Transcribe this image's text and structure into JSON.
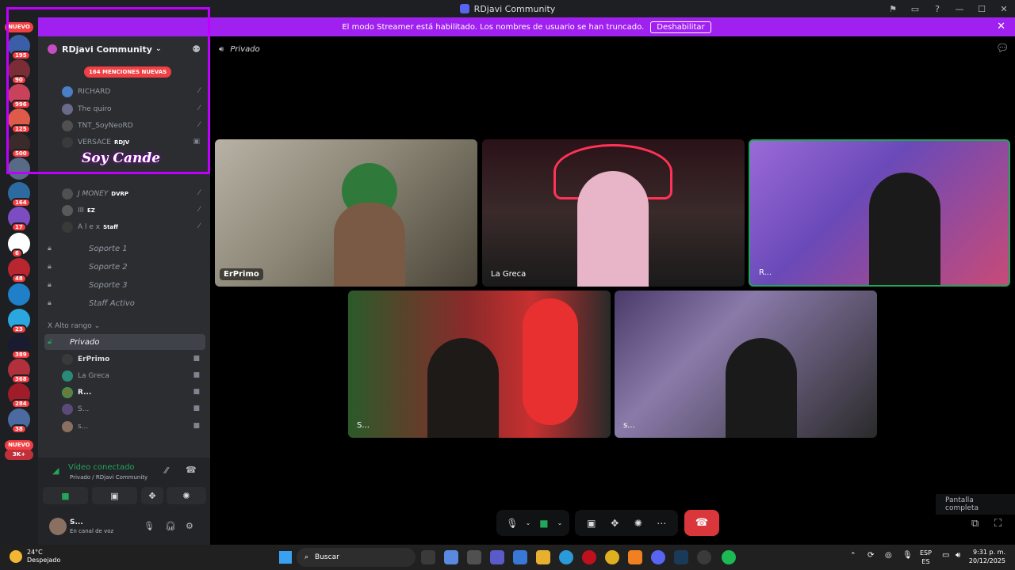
{
  "window": {
    "title": "RDjavi Community"
  },
  "banner": {
    "text": "El modo Streamer está habilitado. Los nombres de usuario se han truncado.",
    "button": "Deshabilitar"
  },
  "rail": {
    "nuevo_top": "NUEVO",
    "nuevo_bottom": "NUEVO",
    "badges": [
      "195",
      "90",
      "996",
      "125",
      "500",
      "164",
      "17",
      "6",
      "48",
      "23",
      "389",
      "368",
      "284",
      "38",
      "3K+"
    ]
  },
  "server": {
    "name": "RDjavi Community"
  },
  "mentions_pill": "164 MENCIONES NUEVAS",
  "members": [
    {
      "name": "RICHARD",
      "tag": ""
    },
    {
      "name": "The quiro",
      "tag": ""
    },
    {
      "name": "TNT_SoyNeoRD",
      "tag": ""
    },
    {
      "name": "VERSACE",
      "tag": "RDJV"
    },
    {
      "name": "J MONEY",
      "tag": "DVRP"
    },
    {
      "name": "III",
      "tag": "EZ"
    },
    {
      "name": "A l e x",
      "tag": "Staff"
    }
  ],
  "channels": [
    {
      "name": "Soporte 1"
    },
    {
      "name": "Soporte 2"
    },
    {
      "name": "Soporte 3"
    },
    {
      "name": "Staff Activo"
    }
  ],
  "category": "Alto rango",
  "active_channel": "Privado",
  "voice_users": [
    "ErPrimo",
    "La Greca",
    "R...",
    "S...",
    "s..."
  ],
  "voice_panel": {
    "status": "Vídeo conectado",
    "sub": "Privado / RDjavi Community"
  },
  "user_panel": {
    "name": "S...",
    "status": "En canal de voz"
  },
  "overlay": {
    "logo": "Soy Cande"
  },
  "call": {
    "channel": "Privado",
    "tiles": [
      "ErPrimo",
      "La Greca",
      "R...",
      "S...",
      "s..."
    ]
  },
  "tooltip": "Pantalla completa",
  "taskbar": {
    "temp": "24°C",
    "weather": "Despejado",
    "search": "Buscar",
    "lang1": "ESP",
    "lang2": "ES",
    "time": "9:31 p. m.",
    "date": "20/12/2025"
  },
  "colors": {
    "streamer_banner": "#a020f0",
    "overlay_border": "#c000ff",
    "hangup": "#da373c",
    "connected": "#23a55a"
  }
}
